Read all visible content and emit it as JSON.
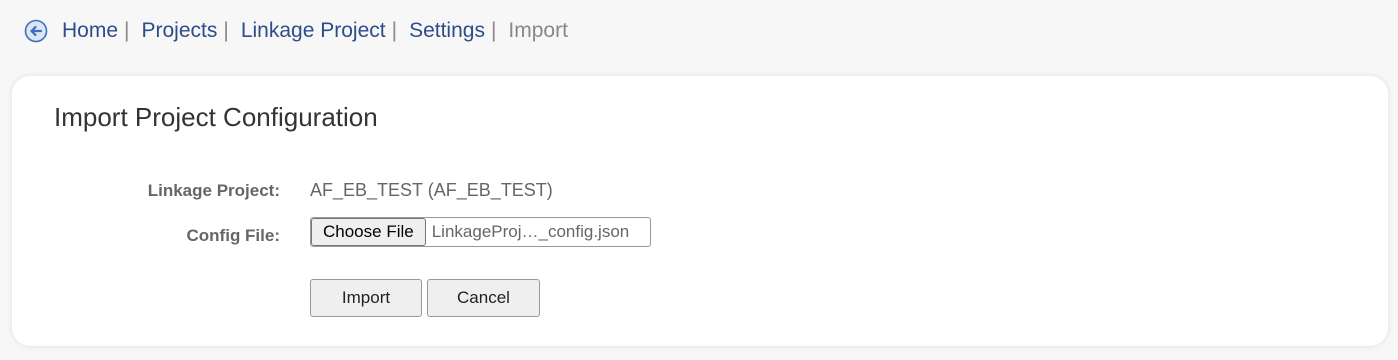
{
  "breadcrumb": {
    "back_icon": "circle-arrow-left-icon",
    "items": [
      {
        "label": "Home"
      },
      {
        "label": "Projects"
      },
      {
        "label": "Linkage Project"
      },
      {
        "label": "Settings"
      }
    ],
    "separator": "|",
    "current": "Import"
  },
  "panel": {
    "title": "Import Project Configuration",
    "linkage_project_label": "Linkage Project:",
    "linkage_project_value": "AF_EB_TEST (AF_EB_TEST)",
    "config_file_label": "Config File:",
    "choose_file_label": "Choose File",
    "file_name": "LinkageProj…_config.json",
    "import_label": "Import",
    "cancel_label": "Cancel"
  },
  "colors": {
    "link": "#2d4d8a",
    "muted": "#888888",
    "label": "#666666",
    "icon_blue": "#3a6fbf"
  }
}
